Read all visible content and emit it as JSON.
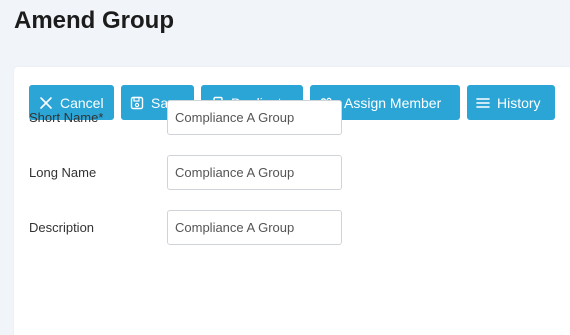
{
  "page": {
    "title": "Amend Group"
  },
  "toolbar": {
    "cancel_label": "Cancel",
    "save_label": "Save",
    "duplicate_label": "Duplicate",
    "assign_member_label": "Assign Member",
    "history_label": "History",
    "button_color": "#2aa5d6"
  },
  "form": {
    "short_name": {
      "label": "Short Name*",
      "value": "Compliance A Group"
    },
    "long_name": {
      "label": "Long Name",
      "value": "Compliance A Group"
    },
    "description": {
      "label": "Description",
      "value": "Compliance A Group"
    }
  },
  "icons": {
    "cancel": "close-icon",
    "save": "save-icon",
    "duplicate": "copy-icon",
    "assign_member": "users-icon",
    "history": "menu-lines-icon"
  }
}
